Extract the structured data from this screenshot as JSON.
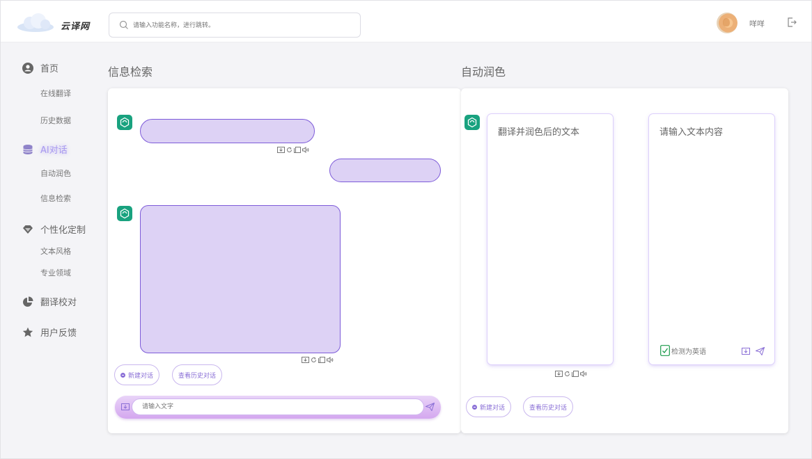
{
  "app": {
    "name": "云译网"
  },
  "search": {
    "placeholder": "请输入功能名称，进行跳转。"
  },
  "user": {
    "name": "咩咩"
  },
  "sidebar": {
    "groups": [
      {
        "label": "首页",
        "icon": "user-circle-icon",
        "subitems": [
          "在线翻译",
          "历史数据"
        ]
      },
      {
        "label": "AI对话",
        "icon": "database-icon",
        "active": true,
        "subitems": [
          "自动润色",
          "信息检索"
        ]
      },
      {
        "label": "个性化定制",
        "icon": "diamond-icon",
        "subitems": [
          "文本风格",
          "专业领域"
        ]
      },
      {
        "label": "翻译校对",
        "icon": "pie-chart-icon",
        "subitems": []
      },
      {
        "label": "用户反馈",
        "icon": "star-icon",
        "subitems": []
      }
    ]
  },
  "left_section": {
    "title": "信息检索",
    "new_chat": "新建对话",
    "history": "查看历史对话",
    "input_placeholder": "请输入文字"
  },
  "right_section": {
    "title": "自动润色",
    "output_card": "翻译并润色后的文本",
    "input_card": "请输入文本内容",
    "detect_label": "检测为英语",
    "new_chat": "新建对话",
    "history": "查看历史对话"
  },
  "colors": {
    "accent": "#7d5bd9",
    "bubble": "#ddd2f5",
    "bot": "#19a27f"
  }
}
